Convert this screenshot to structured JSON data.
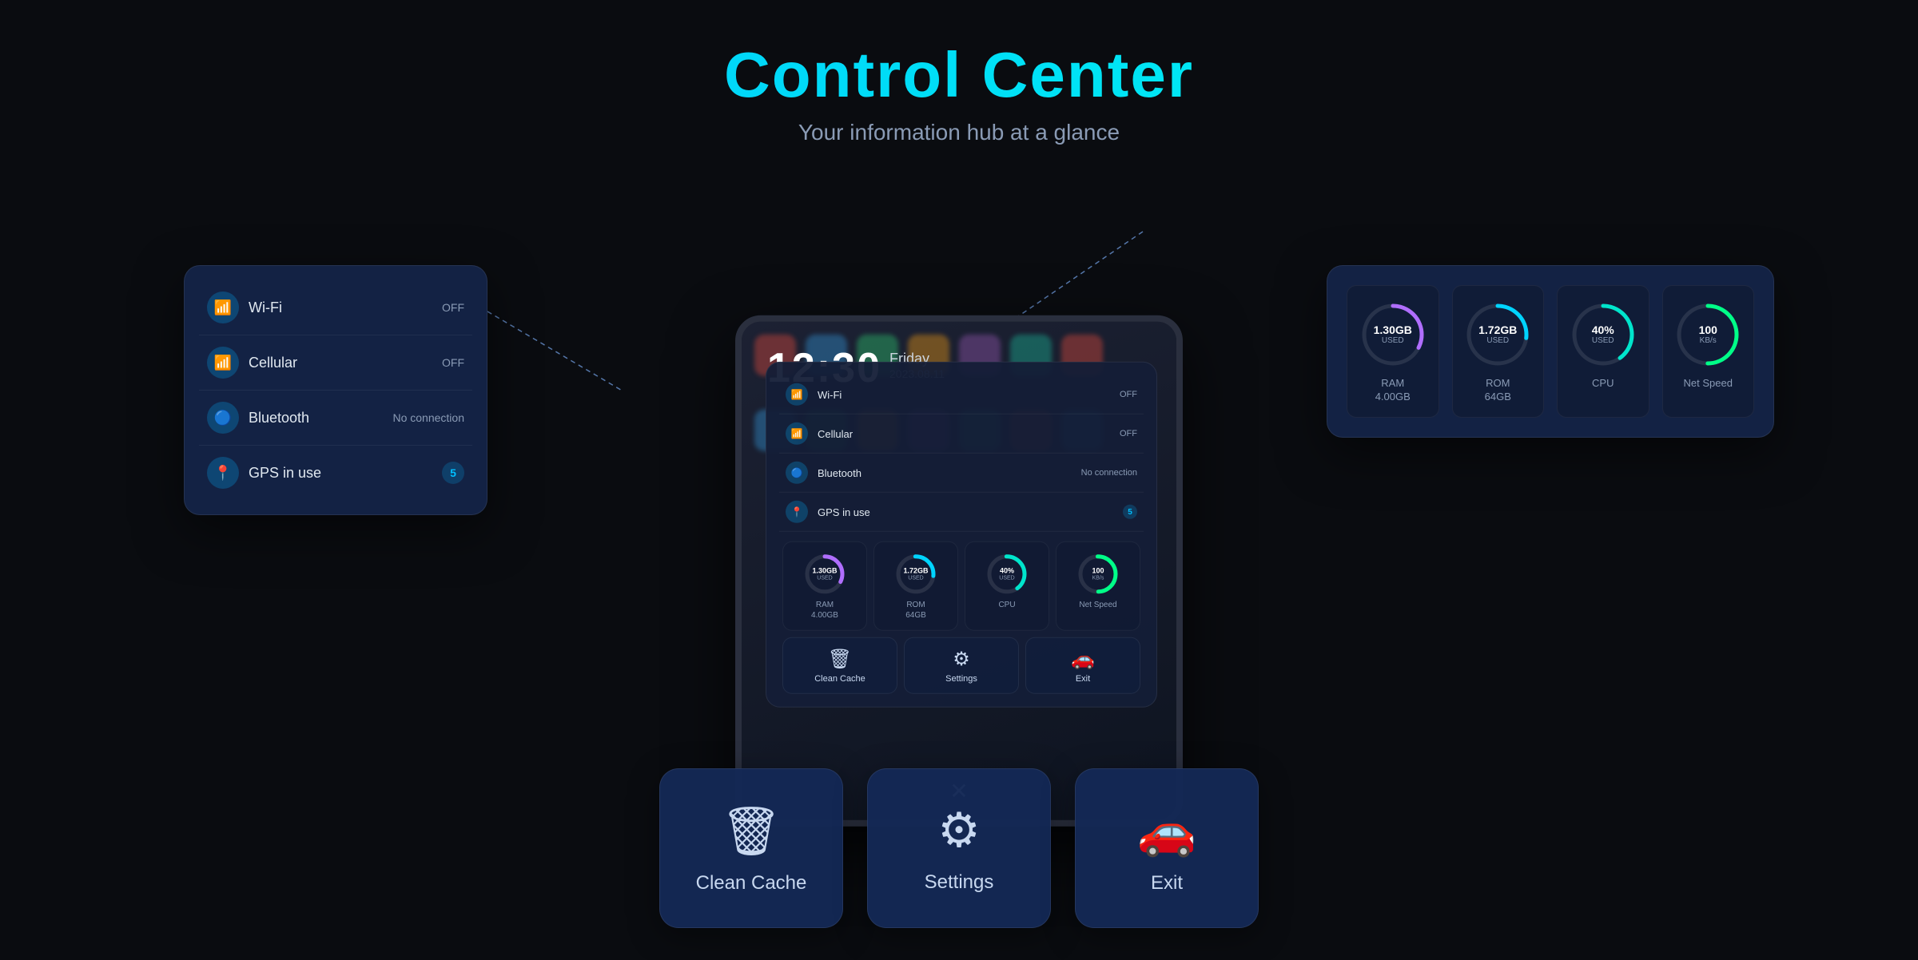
{
  "header": {
    "title": "Control Center",
    "subtitle": "Your information hub at a glance"
  },
  "connectivity": {
    "items": [
      {
        "name": "Wi-Fi",
        "status": "OFF",
        "icon": "wifi"
      },
      {
        "name": "Cellular",
        "status": "OFF",
        "icon": "cellular"
      },
      {
        "name": "Bluetooth",
        "status": "No connection",
        "icon": "bluetooth"
      },
      {
        "name": "GPS in use",
        "status": "5",
        "icon": "gps"
      }
    ]
  },
  "stats": {
    "items": [
      {
        "label": "RAM\n4.00GB",
        "value": "1.30GB",
        "unit": "USED",
        "type": "ram",
        "percent": 32.5
      },
      {
        "label": "ROM\n64GB",
        "value": "1.72GB",
        "unit": "USED",
        "type": "rom",
        "percent": 26.9
      },
      {
        "label": "CPU",
        "value": "40%",
        "unit": "USED",
        "type": "cpu",
        "percent": 40
      },
      {
        "label": "Net Speed",
        "value": "100",
        "unit": "KB/s",
        "type": "net",
        "percent": 50
      }
    ]
  },
  "actions": {
    "items": [
      {
        "name": "clean-cache",
        "label": "Clean Cache",
        "icon": "🗑"
      },
      {
        "name": "settings",
        "label": "Settings",
        "icon": "⚙"
      },
      {
        "name": "exit",
        "label": "Exit",
        "icon": "🚗"
      }
    ]
  },
  "tablet": {
    "time": "12:30",
    "day": "Friday",
    "date": "2023.08.11"
  }
}
